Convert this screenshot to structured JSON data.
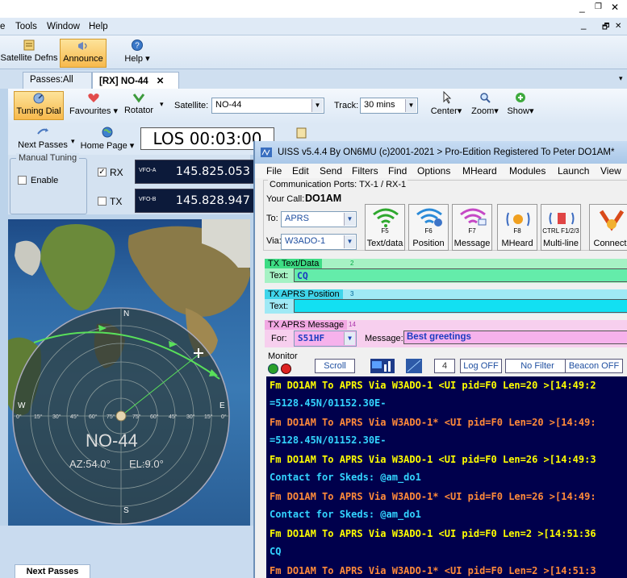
{
  "main_menu": [
    "e",
    "Tools",
    "Window",
    "Help"
  ],
  "window_controls": {
    "minimize": "_",
    "restore": "❐",
    "close": "✕"
  },
  "mdi_controls": {
    "minimize": "_",
    "restore": "🗗",
    "close": "✕"
  },
  "ribbon": {
    "satellite_defns": "Satellite Defns",
    "announce": "Announce",
    "help": "Help"
  },
  "tabs": [
    {
      "label": "Passes:All"
    },
    {
      "label": "[RX] NO-44"
    }
  ],
  "toolbar": {
    "tuning_dial": "Tuning Dial",
    "favourites": "Favourites",
    "rotator": "Rotator",
    "satellite_label": "Satellite:",
    "satellite_value": "NO-44",
    "track_label": "Track:",
    "track_value": "30 mins",
    "center": "Center",
    "zoom": "Zoom",
    "show": "Show",
    "next_passes": "Next Passes",
    "home_page": "Home Page"
  },
  "los": "LOS 00:03:00",
  "manual_tuning": {
    "title": "Manual Tuning",
    "enable": "Enable"
  },
  "vfo": {
    "rx_label": "RX",
    "tx_label": "TX",
    "a_label": "VFO-A",
    "a_value": "145.825.053",
    "b_label": "VFO-B",
    "b_value": "145.828.947"
  },
  "radar": {
    "north": "N",
    "south": "S",
    "west": "W",
    "east": "E",
    "ticks": [
      "0°",
      "15°",
      "30°",
      "45°",
      "60°",
      "75°",
      "75°",
      "60°",
      "45°",
      "30°",
      "15°",
      "0°"
    ],
    "sat_name": "NO-44",
    "azimuth": "AZ:54.0°",
    "elevation": "EL:9.0°"
  },
  "bottom_tab": "Next Passes",
  "uiss": {
    "title": "UISS v5.4.4 By ON6MU (c)2001-2021 > Pro-Edition Registered To Peter DO1AM*",
    "menu": [
      "File",
      "Edit",
      "Send",
      "Filters",
      "Find",
      "Options",
      "MHeard",
      "Modules",
      "Launch",
      "View"
    ],
    "comm_ports": "Communication Ports: TX-1 / RX-1",
    "your_call_label": "Your Call:",
    "your_call": "DO1AM",
    "to_label": "To:",
    "to_value": "APRS",
    "via_label": "Via:",
    "via_value": "W3ADO-1",
    "fkeys": [
      {
        "key": "F5",
        "name": "Text/data"
      },
      {
        "key": "F6",
        "name": "Position"
      },
      {
        "key": "F7",
        "name": "Message"
      },
      {
        "key": "F8",
        "name": "MHeard"
      },
      {
        "key": "CTRL F1/2/3",
        "name": "Multi-line"
      },
      {
        "key": "",
        "name": "Connect"
      }
    ],
    "tx_text": {
      "title": "TX Text/Data",
      "badge": "2",
      "field_label": "Text:",
      "value": "CQ"
    },
    "tx_pos": {
      "title": "TX APRS Position",
      "badge": "3",
      "field_label": "Text:",
      "value": ""
    },
    "tx_msg": {
      "title": "TX APRS Message",
      "badge": "14",
      "for_label": "For:",
      "for_value": "S51HF",
      "message_label": "Message:",
      "message_value": "Best greetings"
    },
    "monitor": {
      "label": "Monitor",
      "scroll": "Scroll",
      "count": "4",
      "log": "Log OFF",
      "filter": "No Filter",
      "beacon": "Beacon OFF"
    },
    "console_lines": [
      {
        "text": "Fm DO1AM To APRS Via W3ADO-1 <UI pid=F0 Len=20 >[14:49:2",
        "color": "#ffff00"
      },
      {
        "text": "=5128.45N/01152.30E-",
        "color": "#33d4ff"
      },
      {
        "text": "Fm DO1AM To APRS Via W3ADO-1* <UI pid=F0 Len=20 >[14:49:",
        "color": "#ff8a3a"
      },
      {
        "text": "=5128.45N/01152.30E-",
        "color": "#33d4ff"
      },
      {
        "text": "Fm DO1AM To APRS Via W3ADO-1 <UI pid=F0 Len=26 >[14:49:3",
        "color": "#ffff00"
      },
      {
        "text": "Contact for Skeds: @am_do1",
        "color": "#33d4ff"
      },
      {
        "text": "Fm DO1AM To APRS Via W3ADO-1* <UI pid=F0 Len=26 >[14:49:",
        "color": "#ff8a3a"
      },
      {
        "text": "Contact for Skeds: @am_do1",
        "color": "#33d4ff"
      },
      {
        "text": "Fm DO1AM To APRS Via W3ADO-1 <UI pid=F0 Len=2 >[14:51:36",
        "color": "#ffff00"
      },
      {
        "text": "CQ",
        "color": "#33d4ff"
      },
      {
        "text": "Fm DO1AM To APRS Via W3ADO-1* <UI pid=F0 Len=2 >[14:51:3",
        "color": "#ff8a3a"
      }
    ]
  }
}
